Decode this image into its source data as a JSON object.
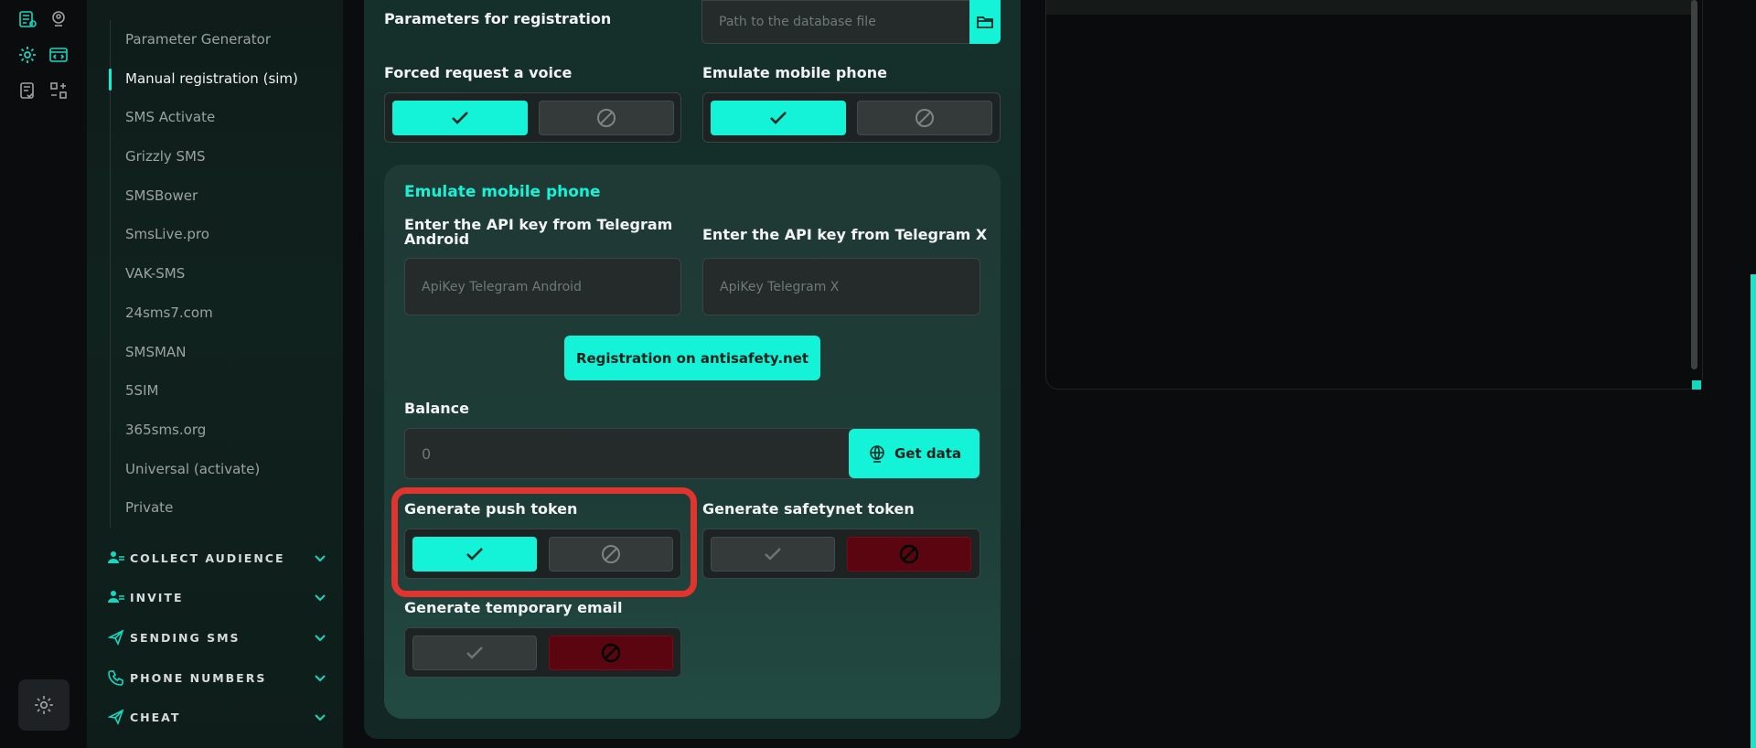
{
  "rail": {
    "icons": [
      "database-list-icon",
      "user-location-icon",
      "gear-icon",
      "code-window-icon",
      "checklist-icon",
      "swap-grid-icon"
    ],
    "settings_icon": "gear-icon"
  },
  "sidebar": {
    "submenu": [
      {
        "label": "Parameter Generator"
      },
      {
        "label": "Manual registration (sim)",
        "active": true
      },
      {
        "label": "SMS Activate"
      },
      {
        "label": "Grizzly SMS"
      },
      {
        "label": "SMSBower"
      },
      {
        "label": "SmsLive.pro"
      },
      {
        "label": "VAK-SMS"
      },
      {
        "label": "24sms7.com"
      },
      {
        "label": "SMSMAN"
      },
      {
        "label": "5SIM"
      },
      {
        "label": "365sms.org"
      },
      {
        "label": "Universal (activate)"
      },
      {
        "label": "Private"
      }
    ],
    "sections": [
      {
        "label": "COLLECT AUDIENCE",
        "icon": "user-group-icon"
      },
      {
        "label": "INVITE",
        "icon": "user-group-icon"
      },
      {
        "label": "SENDING SMS",
        "icon": "send-icon"
      },
      {
        "label": "PHONE NUMBERS",
        "icon": "phone-icon"
      },
      {
        "label": "CHEAT",
        "icon": "send-icon"
      }
    ]
  },
  "main": {
    "params_label": "Parameters for registration",
    "db_placeholder": "Path to the database file",
    "forced_voice_label": "Forced request a voice",
    "emulate_phone_label": "Emulate mobile phone",
    "card": {
      "title": "Emulate mobile phone",
      "api_android_label": "Enter the API key from Telegram Android",
      "api_android_placeholder": "ApiKey Telegram Android",
      "api_x_label": "Enter the API key from Telegram X",
      "api_x_placeholder": "ApiKey Telegram X",
      "register_button": "Registration on antisafety.net",
      "balance_label": "Balance",
      "balance_value": "0",
      "get_data_button": "Get data",
      "push_token_label": "Generate push token",
      "safetynet_label": "Generate safetynet token",
      "temp_email_label": "Generate temporary email"
    },
    "toggles": {
      "forced_voice": "on",
      "emulate_phone": "on",
      "push_token": "on",
      "safetynet_token": "off",
      "temp_email": "off"
    }
  },
  "colors": {
    "accent": "#14f3d7",
    "off_red": "#5a0510",
    "highlight": "#e0342e"
  }
}
